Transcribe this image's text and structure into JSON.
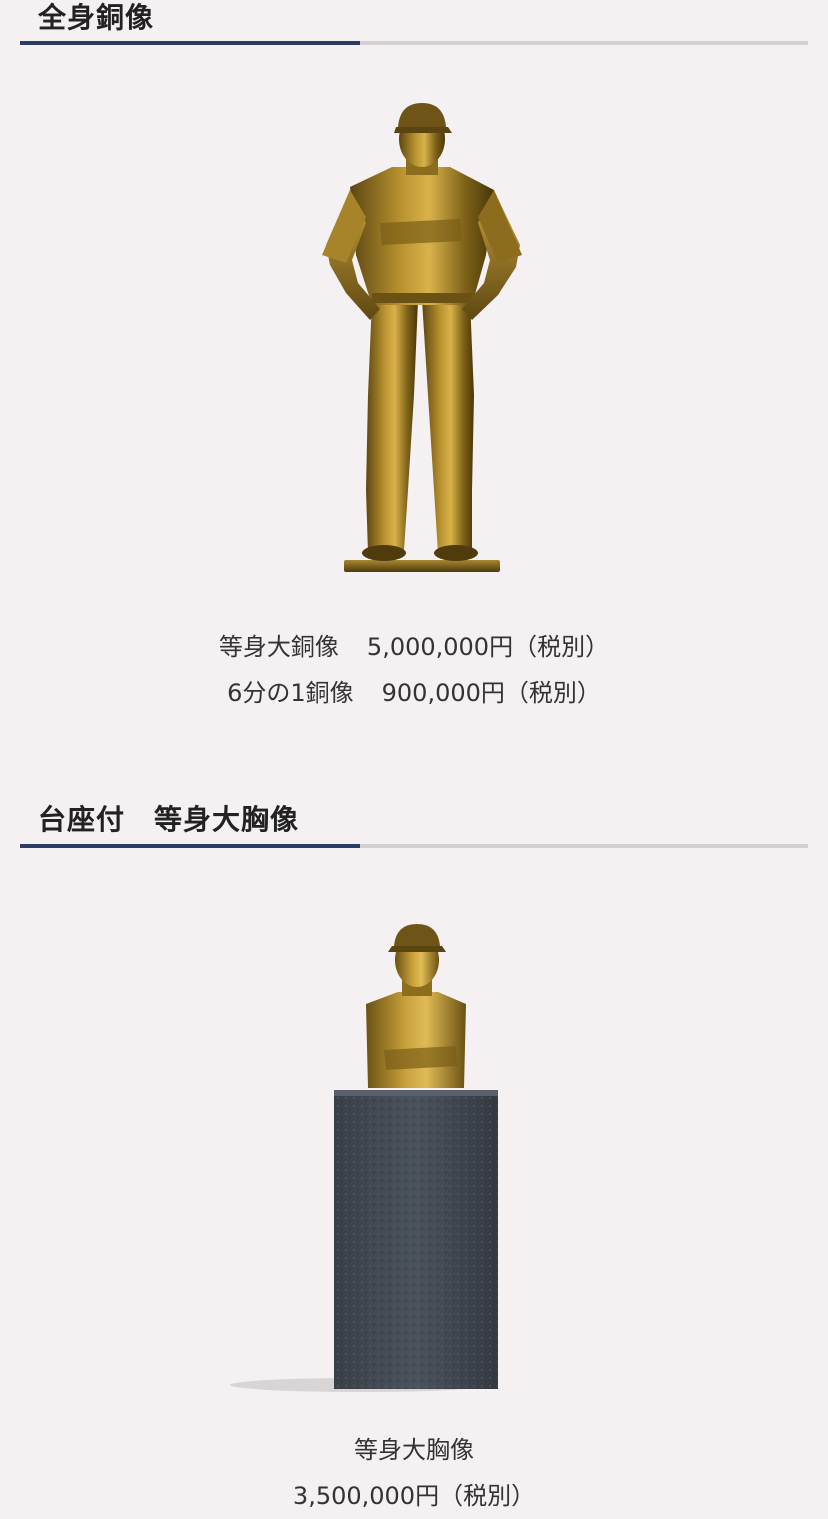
{
  "sections": [
    {
      "title": "全身銅像",
      "prices": [
        {
          "label": "等身大銅像",
          "price": "5,000,000円（税別）"
        },
        {
          "label": "6分の1銅像",
          "price": "900,000円（税別）"
        }
      ]
    },
    {
      "title": "台座付　等身大胸像",
      "prices": [
        {
          "label": "等身大胸像",
          "price": "3,500,000円（税別）"
        }
      ]
    }
  ],
  "colors": {
    "background": "#f5f0f1",
    "rule_accent": "#2c3d64",
    "rule_base": "#d3d1d3",
    "bronze": "#9a7a2e",
    "pedestal": "#3d444d"
  }
}
